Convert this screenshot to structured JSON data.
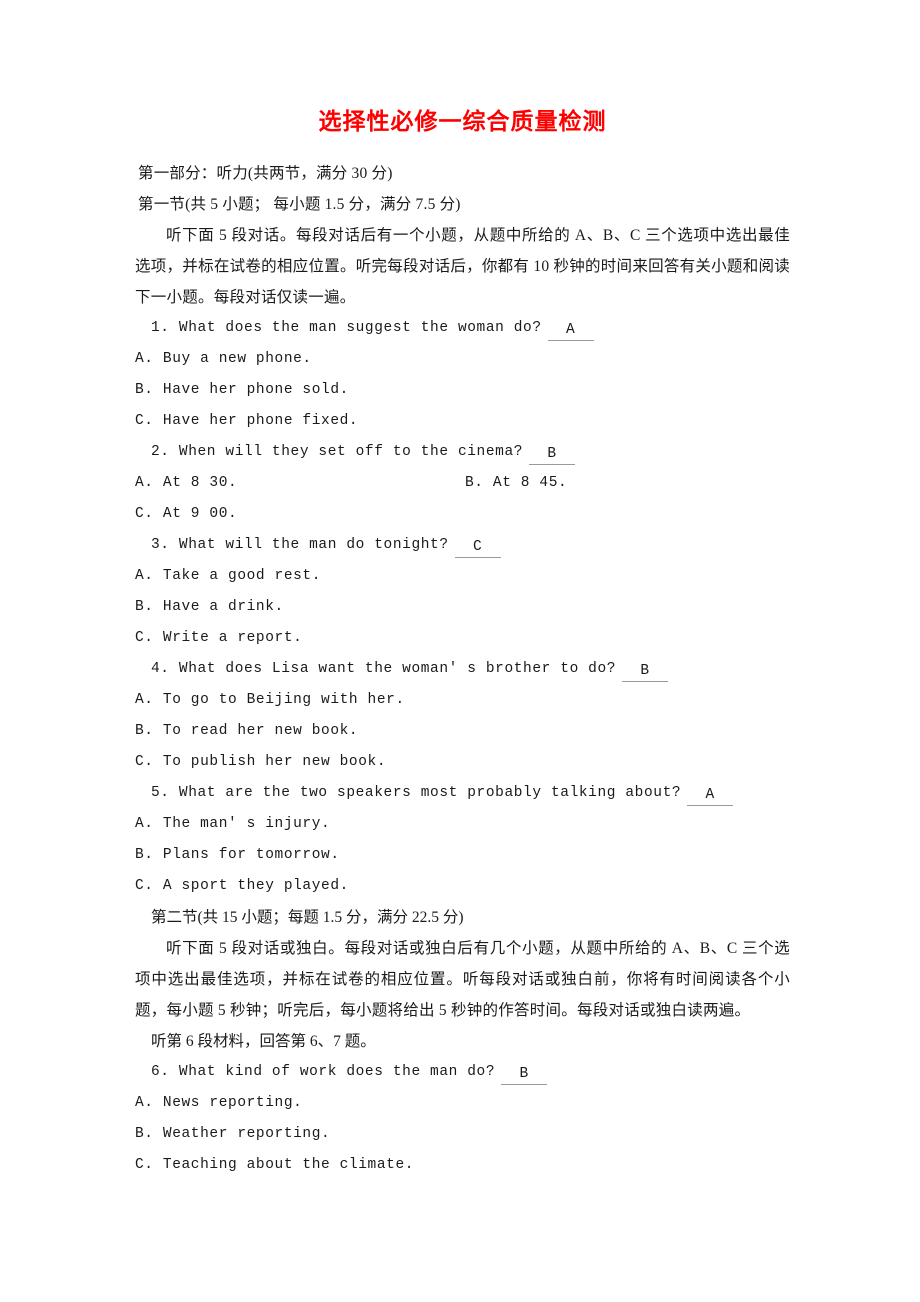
{
  "document": {
    "title": "选择性必修一综合质量检测",
    "title_color": "#ff0000",
    "part_one": "第一部分：听力(共两节，满分 30 分)",
    "section_one_header": "第一节(共 5 小题；  每小题 1.5 分，满分 7.5 分)",
    "section_one_instructions": "听下面 5 段对话。每段对话后有一个小题，从题中所给的 A、B、C 三个选项中选出最佳选项，并标在试卷的相应位置。听完每段对话后，你都有 10 秒钟的时间来回答有关小题和阅读下一小题。每段对话仅读一遍。",
    "section_two_header": "第二节(共 15 小题；每题 1.5 分，满分 22.5 分)",
    "section_two_instructions": "听下面 5 段对话或独白。每段对话或独白后有几个小题，从题中所给的 A、B、C 三个选项中选出最佳选项，并标在试卷的相应位置。听每段对话或独白前，你将有时间阅读各个小题，每小题 5 秒钟；听完后，每小题将给出 5 秒钟的作答时间。每段对话或独白读两遍。",
    "material_six_note": "听第 6 段材料，回答第 6、7 题。"
  },
  "questions": [
    {
      "number": "1.",
      "stem": "1. What does the man suggest the woman do?",
      "answer": "A",
      "layout": "stacked",
      "options": [
        "A. Buy a new phone.",
        "B. Have her phone sold.",
        "C. Have her phone fixed."
      ]
    },
    {
      "number": "2.",
      "stem": "2. When will they set off to the cinema?",
      "answer": "B",
      "layout": "two-column",
      "options": [
        "A. At 8  30.",
        "B. At 8  45.",
        "C. At 9  00."
      ]
    },
    {
      "number": "3.",
      "stem": "3. What will the man do tonight?",
      "answer": "C",
      "layout": "stacked",
      "options": [
        "A. Take a good rest.",
        "B. Have a drink.",
        "C. Write a report."
      ]
    },
    {
      "number": "4.",
      "stem": "4. What does Lisa want the woman' s brother to do?",
      "answer": "B",
      "layout": "stacked",
      "options": [
        "A. To go to Beijing with her.",
        "B. To read her new book.",
        "C. To publish her new book."
      ]
    },
    {
      "number": "5.",
      "stem": "5. What are the two speakers most probably talking about?",
      "answer": "A",
      "layout": "stacked",
      "options": [
        "A. The man' s injury.",
        "B. Plans for tomorrow.",
        "C. A sport they played."
      ]
    },
    {
      "number": "6.",
      "stem": "6. What kind of work does the man do?",
      "answer": "B",
      "layout": "stacked",
      "options": [
        "A. News reporting.",
        "B. Weather reporting.",
        "C. Teaching about the climate."
      ]
    }
  ]
}
